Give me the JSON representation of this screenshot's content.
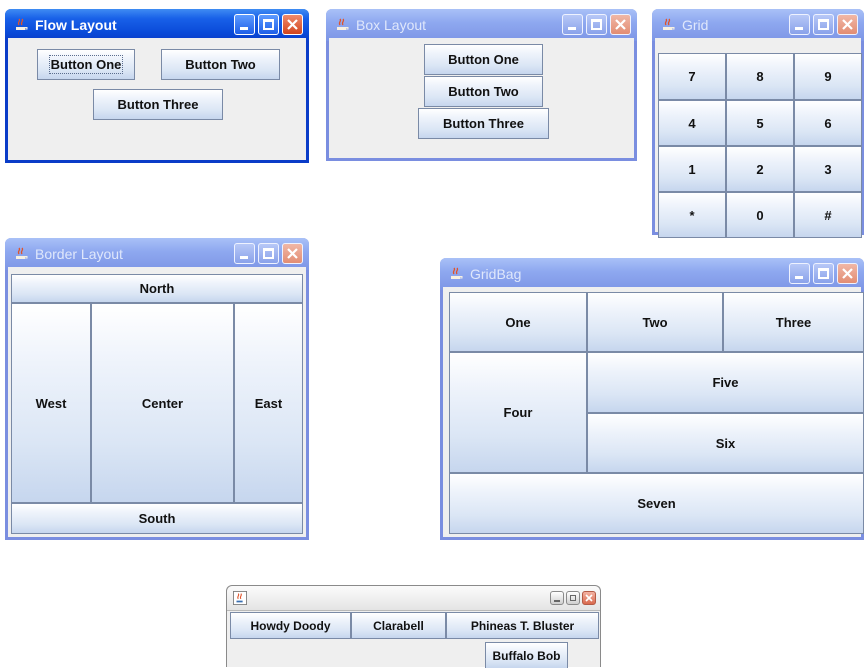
{
  "flow": {
    "title": "Flow Layout",
    "buttons": [
      "Button One",
      "Button Two",
      "Button Three"
    ]
  },
  "box": {
    "title": "Box Layout",
    "buttons": [
      "Button One",
      "Button Two",
      "Button Three"
    ]
  },
  "grid": {
    "title": "Grid",
    "keys": [
      "7",
      "8",
      "9",
      "4",
      "5",
      "6",
      "1",
      "2",
      "3",
      "*",
      "0",
      "#"
    ]
  },
  "border": {
    "title": "Border Layout",
    "north": "North",
    "west": "West",
    "center": "Center",
    "east": "East",
    "south": "South"
  },
  "gridbag": {
    "title": "GridBag",
    "buttons": [
      "One",
      "Two",
      "Three",
      "Four",
      "Five",
      "Six",
      "Seven"
    ]
  },
  "custom": {
    "title": "",
    "buttons": [
      "Howdy Doody",
      "Clarabell",
      "Phineas T. Bluster",
      "Buffalo Bob"
    ]
  },
  "colors": {
    "active_titlebar": "#0a3cc8",
    "inactive_titlebar": "#8fa9f0",
    "close_button": "#d2451d"
  }
}
